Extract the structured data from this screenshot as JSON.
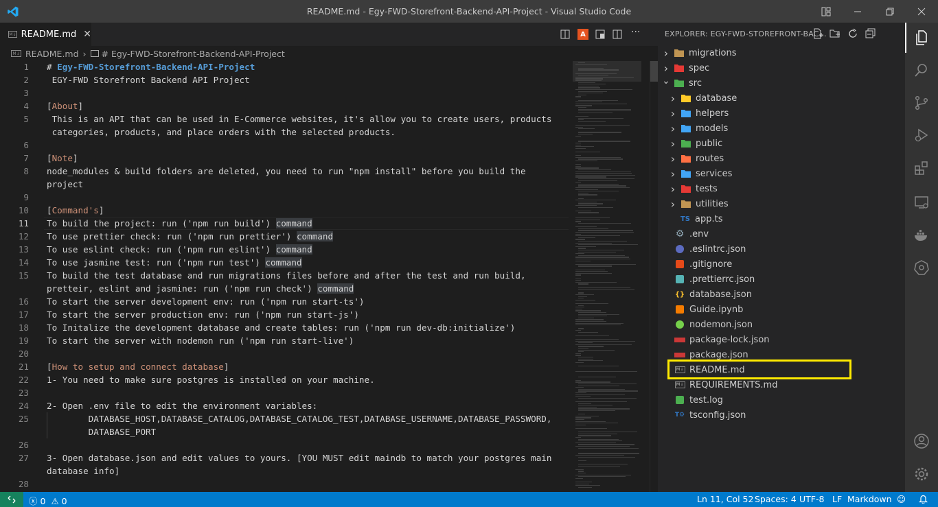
{
  "window": {
    "title": "README.md - Egy-FWD-Storefront-Backend-API-Project - Visual Studio Code"
  },
  "tab": {
    "label": "README.md",
    "icon": "markdown-icon"
  },
  "breadcrumb": {
    "file": "README.md",
    "symbol": "# Egy-FWD-Storefront-Backend-API-Project"
  },
  "editor": {
    "active_line": 11,
    "lines": [
      {
        "n": "1",
        "text": "# Egy-FWD-Storefront-Backend-API-Project"
      },
      {
        "n": "2",
        "text": " EGY-FWD Storefront Backend API Project"
      },
      {
        "n": "3",
        "text": ""
      },
      {
        "n": "4",
        "text": "[About]"
      },
      {
        "n": "5",
        "text": " This is an API that can be used in E-Commerce websites, it's allow you to create users, products"
      },
      {
        "n": "",
        "text": " categories, products, and place orders with the selected products."
      },
      {
        "n": "6",
        "text": ""
      },
      {
        "n": "7",
        "text": "[Note]"
      },
      {
        "n": "8",
        "text": "node_modules & build folders are deleted, you need to run \"npm install\" before you build the"
      },
      {
        "n": "",
        "text": "project"
      },
      {
        "n": "9",
        "text": ""
      },
      {
        "n": "10",
        "text": "[Command's]"
      },
      {
        "n": "11",
        "text": "To build the project: run ('npm run build') ",
        "hl": "command"
      },
      {
        "n": "12",
        "text": "To use prettier check: run ('npm run prettier') ",
        "hl": "command"
      },
      {
        "n": "13",
        "text": "To use eslint check: run ('npm run eslint') ",
        "hl": "command"
      },
      {
        "n": "14",
        "text": "To use jasmine test: run ('npm run test') ",
        "hl": "command"
      },
      {
        "n": "15",
        "text": "To build the test database and run migrations files before and after the test and run build,"
      },
      {
        "n": "",
        "text": "pretteir, eslint and jasmine: run ('npm run check') ",
        "hl": "command"
      },
      {
        "n": "16",
        "text": "To start the server development env: run ('npm run start-ts')"
      },
      {
        "n": "17",
        "text": "To start the server production env: run ('npm run start-js')"
      },
      {
        "n": "18",
        "text": "To Initalize the development database and create tables: run ('npm run dev-db:initialize')"
      },
      {
        "n": "19",
        "text": "To start the server with nodemon run ('npm run start-live')"
      },
      {
        "n": "20",
        "text": ""
      },
      {
        "n": "21",
        "text": "[How to setup and connect database]"
      },
      {
        "n": "22",
        "text": "1- You need to make sure postgres is installed on your machine."
      },
      {
        "n": "23",
        "text": ""
      },
      {
        "n": "24",
        "text": "2- Open .env file to edit the environment variables:"
      },
      {
        "n": "25",
        "text": "        DATABASE_HOST,DATABASE_CATALOG,DATABASE_CATALOG_TEST,DATABASE_USERNAME,DATABASE_PASSWORD,"
      },
      {
        "n": "",
        "text": "        DATABASE_PORT"
      },
      {
        "n": "26",
        "text": ""
      },
      {
        "n": "27",
        "text": "3- Open database.json and edit values to yours. [YOU MUST edit maindb to match your postgres main"
      },
      {
        "n": "",
        "text": "database info]"
      },
      {
        "n": "28",
        "text": ""
      }
    ]
  },
  "explorer": {
    "header": "EXPLORER: EGY-FWD-STOREFRONT-BAC...",
    "items": [
      {
        "label": "migrations",
        "type": "folder",
        "depth": 0,
        "icon": "folder-icon",
        "color": "#c09553"
      },
      {
        "label": "spec",
        "type": "folder",
        "depth": 0,
        "icon": "folder-spec-icon",
        "color": "#e53935"
      },
      {
        "label": "src",
        "type": "folder-open",
        "depth": 0,
        "icon": "folder-src-icon",
        "color": "#4caf50"
      },
      {
        "label": "database",
        "type": "folder",
        "depth": 1,
        "icon": "folder-database-icon",
        "color": "#ffca28"
      },
      {
        "label": "helpers",
        "type": "folder",
        "depth": 1,
        "icon": "folder-helpers-icon",
        "color": "#42a5f5"
      },
      {
        "label": "models",
        "type": "folder",
        "depth": 1,
        "icon": "folder-models-icon",
        "color": "#42a5f5"
      },
      {
        "label": "public",
        "type": "folder",
        "depth": 1,
        "icon": "folder-public-icon",
        "color": "#4caf50"
      },
      {
        "label": "routes",
        "type": "folder",
        "depth": 1,
        "icon": "folder-routes-icon",
        "color": "#ff7043"
      },
      {
        "label": "services",
        "type": "folder",
        "depth": 1,
        "icon": "folder-services-icon",
        "color": "#42a5f5"
      },
      {
        "label": "tests",
        "type": "folder",
        "depth": 1,
        "icon": "folder-tests-icon",
        "color": "#e53935"
      },
      {
        "label": "utilities",
        "type": "folder",
        "depth": 1,
        "icon": "folder-icon",
        "color": "#c09553"
      },
      {
        "label": "app.ts",
        "type": "file",
        "depth": 2,
        "icon": "typescript-icon",
        "color": "#3178c6"
      },
      {
        "label": ".env",
        "type": "file",
        "depth": 0,
        "icon": "gear-icon",
        "color": "#7f8c8d"
      },
      {
        "label": ".eslintrc.json",
        "type": "file",
        "depth": 0,
        "icon": "eslint-icon",
        "color": "#5c6bc0"
      },
      {
        "label": ".gitignore",
        "type": "file",
        "depth": 0,
        "icon": "git-icon",
        "color": "#e64a19"
      },
      {
        "label": ".prettierrc.json",
        "type": "file",
        "depth": 0,
        "icon": "prettier-icon",
        "color": "#56b3b4"
      },
      {
        "label": "database.json",
        "type": "file",
        "depth": 0,
        "icon": "json-icon",
        "color": "#fbc02d"
      },
      {
        "label": "Guide.ipynb",
        "type": "file",
        "depth": 0,
        "icon": "jupyter-icon",
        "color": "#f57c00"
      },
      {
        "label": "nodemon.json",
        "type": "file",
        "depth": 0,
        "icon": "nodemon-icon",
        "color": "#76d04b"
      },
      {
        "label": "package-lock.json",
        "type": "file",
        "depth": 0,
        "icon": "npm-icon",
        "color": "#cb3837"
      },
      {
        "label": "package.json",
        "type": "file",
        "depth": 0,
        "icon": "npm-icon",
        "color": "#cb3837"
      },
      {
        "label": "README.md",
        "type": "file",
        "depth": 0,
        "icon": "markdown-icon",
        "color": "#8a8a8a"
      },
      {
        "label": "REQUIREMENTS.md",
        "type": "file",
        "depth": 0,
        "icon": "markdown-icon",
        "color": "#8a8a8a"
      },
      {
        "label": "test.log",
        "type": "file",
        "depth": 0,
        "icon": "log-icon",
        "color": "#4caf50"
      },
      {
        "label": "tsconfig.json",
        "type": "file",
        "depth": 0,
        "icon": "tsconfig-icon",
        "color": "#3178c6"
      }
    ]
  },
  "statusbar": {
    "errors": "0",
    "warnings": "0",
    "position": "Ln 11, Col 52",
    "spaces": "Spaces: 4",
    "encoding": "UTF-8",
    "eol": "LF",
    "language": "Markdown"
  },
  "colors": {
    "accent": "#007acc",
    "highlight_box": "#ffeb00",
    "heading": "#569cd6",
    "bracket": "#ce9178"
  }
}
